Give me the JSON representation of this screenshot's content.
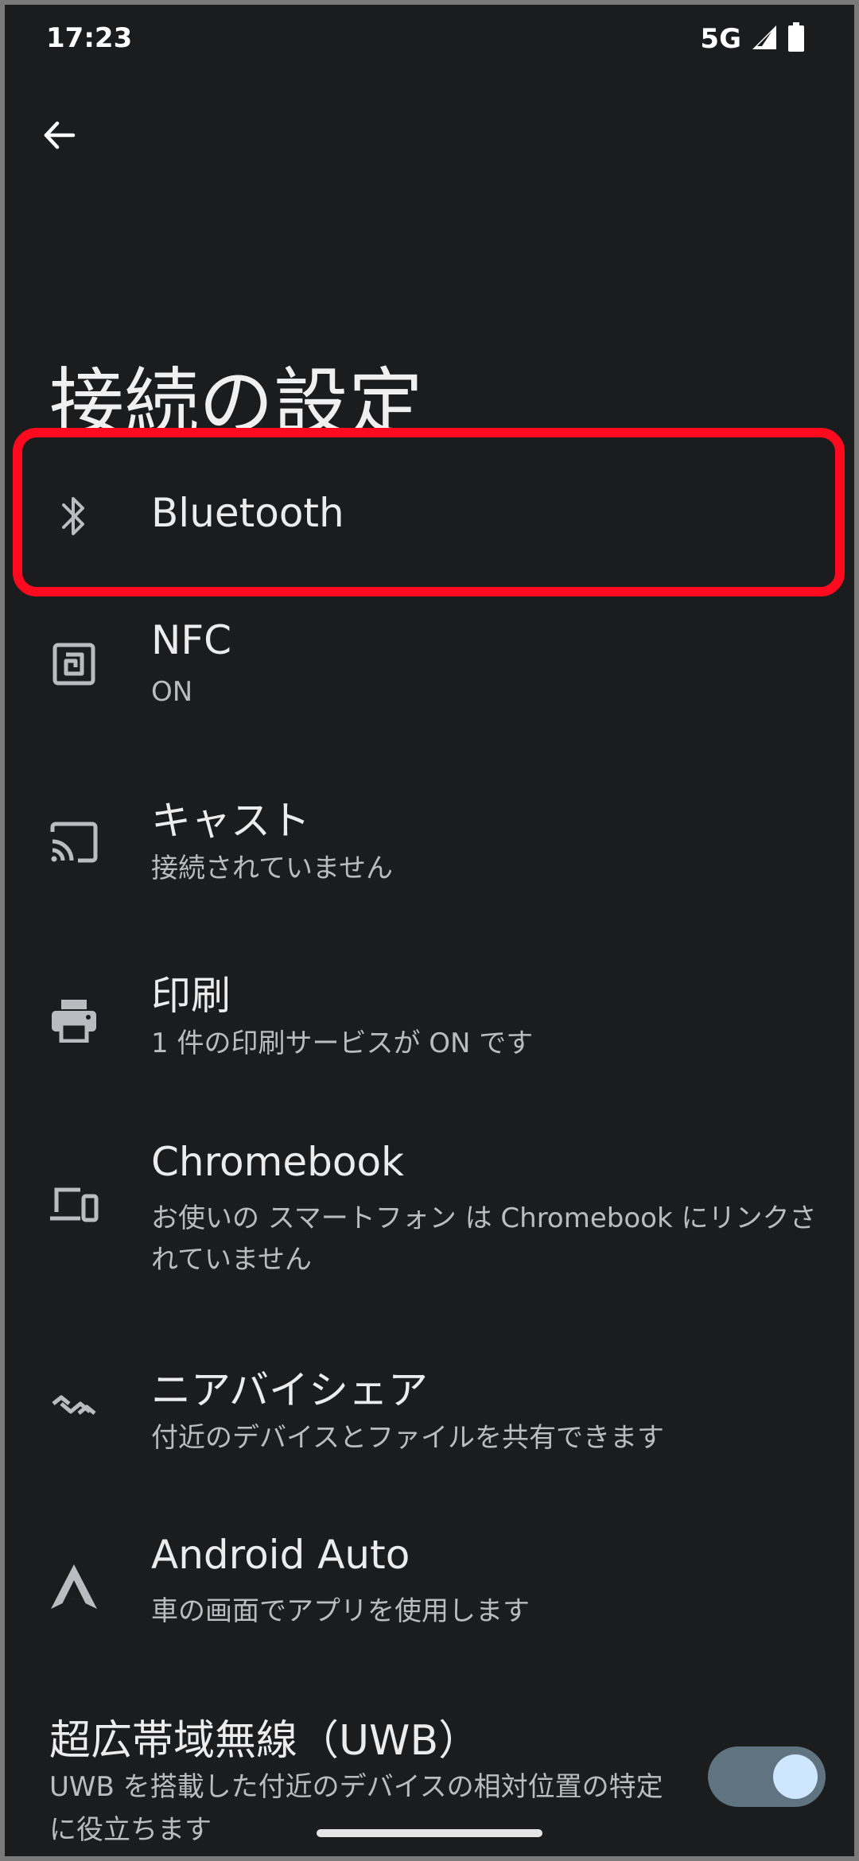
{
  "status_bar": {
    "time": "17:23",
    "network": "5G"
  },
  "header": {
    "back_icon": "arrow-back-icon",
    "title": "接続の設定"
  },
  "items": [
    {
      "icon": "bluetooth-icon",
      "title": "Bluetooth",
      "subtitle": ""
    },
    {
      "icon": "nfc-icon",
      "title": "NFC",
      "subtitle": "ON"
    },
    {
      "icon": "cast-icon",
      "title": "キャスト",
      "subtitle": "接続されていません"
    },
    {
      "icon": "print-icon",
      "title": "印刷",
      "subtitle": "1 件の印刷サービスが ON です"
    },
    {
      "icon": "chromebook-icon",
      "title": "Chromebook",
      "subtitle": "お使いの スマートフォン は Chromebook にリンクされていません"
    },
    {
      "icon": "nearby-share-icon",
      "title": "ニアバイシェア",
      "subtitle": "付近のデバイスとファイルを共有できます"
    },
    {
      "icon": "android-auto-icon",
      "title": "Android Auto",
      "subtitle": "車の画面でアプリを使用します"
    }
  ],
  "uwb": {
    "title": "超広帯域無線（UWB）",
    "subtitle": "UWB を搭載した付近のデバイスの相対位置の特定に役立ちます",
    "toggle_on": true
  },
  "colors": {
    "background": "#1b1c1e",
    "highlight": "#ff0a1e",
    "toggle_track": "#5f7480",
    "toggle_knob": "#cfe6ff"
  }
}
